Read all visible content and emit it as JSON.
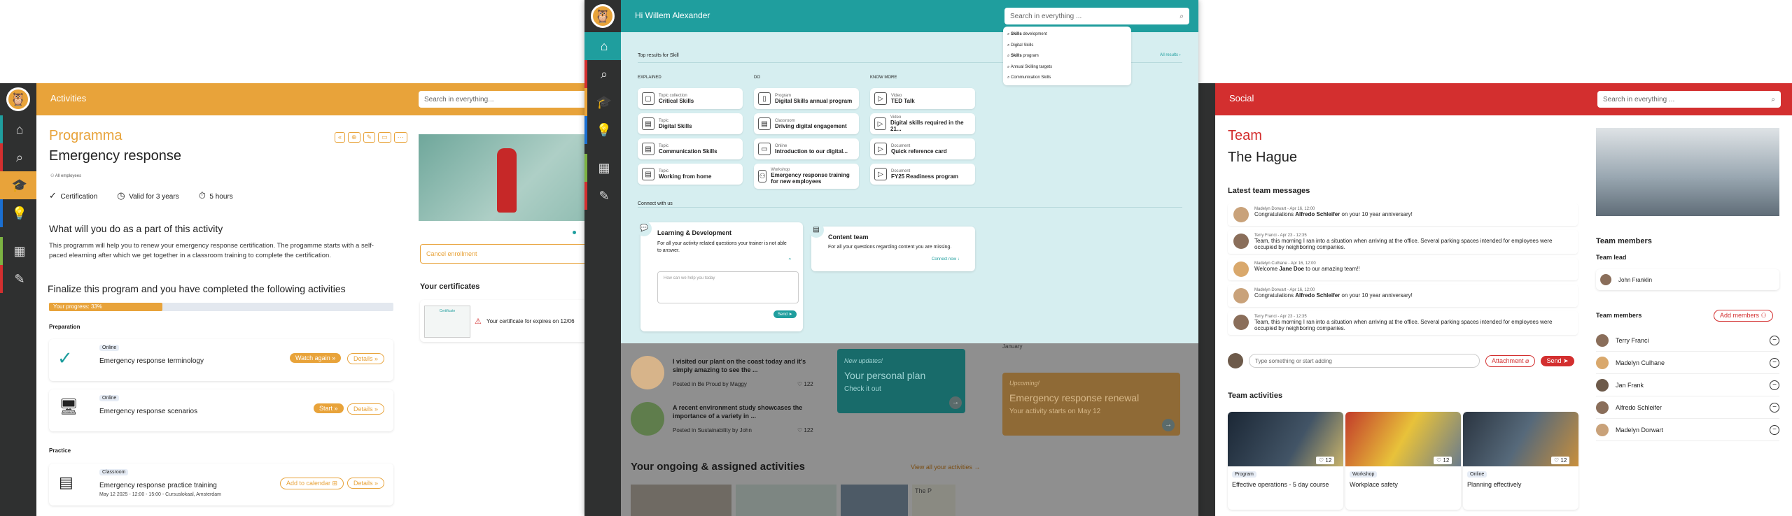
{
  "activities_window": {
    "header_title": "Activities",
    "search_placeholder": "Search in everything...",
    "subtitle": "Programma",
    "title": "Emergency response",
    "audience": "All employees",
    "meta": [
      "Certification",
      "Valid for 3 years",
      "5 hours"
    ],
    "what_heading": "What will you do as a part of this activity",
    "what_text": "This programm will help you to renew your emergency response certification. The progamme starts with a self-paced elearning after which we get together in a classroom training to complete the certification.",
    "finalize_heading": "Finalize this program and you have completed the following activities",
    "progress_label": "Your progress: 33%",
    "progress": 0.33,
    "section_preparation": "Preparation",
    "section_practice": "Practice",
    "items": [
      {
        "tag": "Online",
        "title": "Emergency response terminology",
        "action": "Watch again",
        "details": "Details"
      },
      {
        "tag": "Online",
        "title": "Emergency response scenarios",
        "action": "Start",
        "details": "Details"
      },
      {
        "tag": "Classroom",
        "title": "Emergency response practice training",
        "sub": "May 12 2025 - 12:00 - 15:00 - Cursuslokaal, Amsterdam",
        "action": "Add to calendar",
        "details": "Details"
      }
    ],
    "cancel_enrollment": "Cancel enrollment",
    "certificates_heading": "Your certificates",
    "certificate_thumb": "Certificate",
    "certificate_text": "Your certificate for expires on 12/06"
  },
  "center_window": {
    "greeting": "Hi Willem Alexander",
    "search_placeholder": "Search in everything ...",
    "suggestions": [
      {
        "b": "Skills",
        "r": " development"
      },
      {
        "b": "",
        "r": "Digital Skills"
      },
      {
        "b": "Skills",
        "r": " program"
      },
      {
        "b": "",
        "r": "Annual Skilling targets"
      },
      {
        "b": "",
        "r": "Communication Skills"
      }
    ],
    "top_results": "Top results for Skill",
    "all_results": "All results",
    "col_heads": [
      "EXPLAINED",
      "DO",
      "KNOW MORE"
    ],
    "col1": [
      {
        "t": "Topic collection",
        "n": "Critical Skills"
      },
      {
        "t": "Topic",
        "n": "Digital Skills"
      },
      {
        "t": "Topic",
        "n": "Communication Skills"
      },
      {
        "t": "Topic",
        "n": "Working from home"
      }
    ],
    "col2": [
      {
        "t": "Program",
        "n": "Digital Skills annual program"
      },
      {
        "t": "Classroom",
        "n": "Driving digital engagement"
      },
      {
        "t": "Online",
        "n": "Introduction to our digital..."
      },
      {
        "t": "Workshop",
        "n": "Emergency response training for new employees"
      }
    ],
    "col3": [
      {
        "t": "Video",
        "n": "TED Talk"
      },
      {
        "t": "Video",
        "n": "Digital skills required in the 21..."
      },
      {
        "t": "Document",
        "n": "Quick reference card"
      },
      {
        "t": "Document",
        "n": "FY25 Readiness program"
      }
    ],
    "connect_with_us": "Connect with us",
    "ld_title": "Learning & Development",
    "ld_text": "For all your activity related questions your trainer is not able to answer.",
    "ld_placeholder": "How can we help you today",
    "send": "Send",
    "ct_title": "Content team",
    "ct_text": "For all your questions regarding content you are missing.",
    "connect_now": "Connect now",
    "posts": [
      {
        "text": "I visited our plant on the coast today and it's simply amazing to see the ...",
        "meta": "Posted in Be Proud by Maggy",
        "likes": "122"
      },
      {
        "text": "A recent environment study showcases the importance of a variety in ...",
        "meta": "Posted in Sustainability by John",
        "likes": "122"
      }
    ],
    "plan_kicker": "New updates!",
    "plan_title": "Your personal plan",
    "plan_sub": "Check it out",
    "calendar_label": "January",
    "upcoming_kicker": "Upcoming!",
    "upcoming_title": "Emergency response renewal",
    "upcoming_sub": "Your activity starts on May 12",
    "ongoing_heading": "Your ongoing & assigned activities",
    "view_all": "View all your activities",
    "the_p": "The P"
  },
  "social_window": {
    "header_title": "Social",
    "search_placeholder": "Search in everything ...",
    "subtitle": "Team",
    "title": "The Hague",
    "latest_heading": "Latest team messages",
    "messages": [
      {
        "meta": "Madelyn Dorwart - Apr 16, 12:00",
        "pre": "Congratulations ",
        "bold": "Alfredo Schleifer",
        "post": " on your 10 year anniversary!"
      },
      {
        "meta": "Terry Franci - Apr 23 - 12:35",
        "pre": "Team, this morning I ran into a situation when arriving at the office. Several parking spaces intended for employees were occupied by neighboring companies.",
        "bold": "",
        "post": ""
      },
      {
        "meta": "Madelyn Culhane - Apr 16, 12:00",
        "pre": "Welcome ",
        "bold": "Jane Doe",
        "post": " to our amazing team!!"
      },
      {
        "meta": "Madelyn Dorwart - Apr 16, 12:00",
        "pre": "Congratulations ",
        "bold": "Alfredo Schleifer",
        "post": " on your 10 year anniversary!"
      },
      {
        "meta": "Terry Franci - Apr 23 - 12:35",
        "pre": "Team, this morning I ran into a situation when arriving at the office. Several parking spaces intended for employees were occupied by neighboring companies.",
        "bold": "",
        "post": ""
      }
    ],
    "compose_placeholder": "Type something or start adding",
    "attachment": "Attachment",
    "send": "Send",
    "team_activities": "Team activities",
    "activities": [
      {
        "likes": "12",
        "tag": "Program",
        "title": "Effective operations - 5 day course"
      },
      {
        "likes": "12",
        "tag": "Workshop",
        "title": "Workplace safety"
      },
      {
        "likes": "12",
        "tag": "Online",
        "title": "Planning effectively"
      }
    ],
    "team_members_heading": "Team members",
    "team_lead_label": "Team lead",
    "team_lead": "John Franklin",
    "members_label": "Team members",
    "add_members": "Add members",
    "members": [
      "Terry Franci",
      "Madelyn Culhane",
      "Jan Frank",
      "Alfredo Schleifer",
      "Madelyn Dorwart"
    ]
  },
  "colors": {
    "orange": "#e8a33a",
    "teal": "#1f9e9e",
    "red": "#d32f2f",
    "rail": "#2f3030"
  }
}
